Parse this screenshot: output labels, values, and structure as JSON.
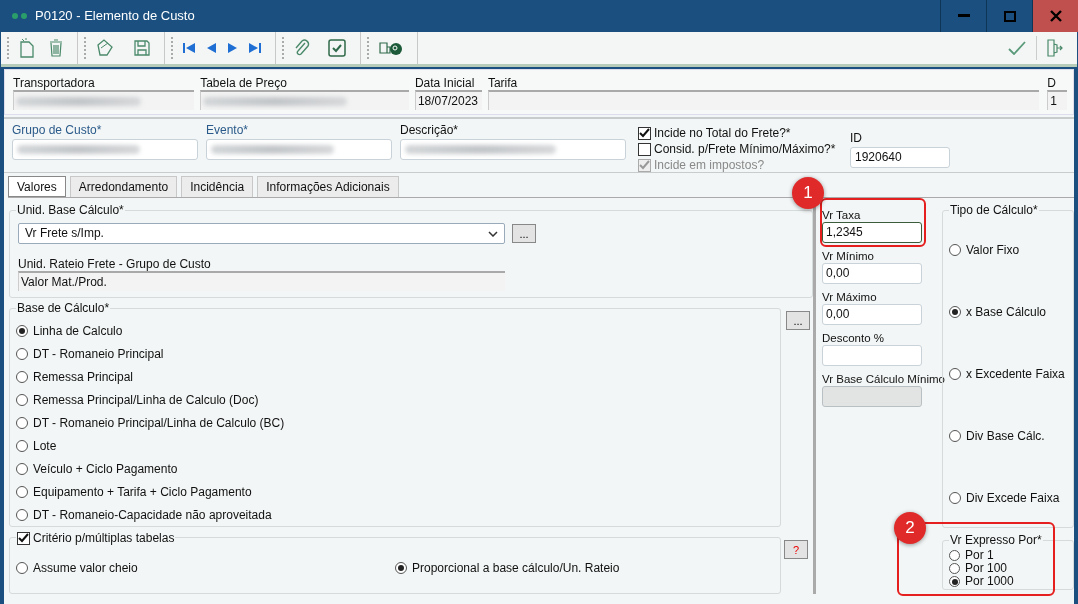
{
  "window": {
    "title": "P0120 - Elemento de Custo"
  },
  "header": {
    "fields": [
      {
        "label": "Transportadora",
        "redacted": true
      },
      {
        "label": "Tabela de Preço",
        "redacted": true
      },
      {
        "label": "Data Inicial",
        "value": "18/07/2023"
      },
      {
        "label": "Tarifa"
      },
      {
        "label": "D",
        "value": "1"
      }
    ]
  },
  "group": {
    "fields": [
      {
        "label": "Grupo de Custo*",
        "kind": "lookup",
        "redacted": true
      },
      {
        "label": "Evento*",
        "kind": "lookup",
        "redacted": true
      },
      {
        "label": "Descrição*",
        "kind": "text",
        "redacted": true
      }
    ],
    "checkboxes": [
      {
        "label": "Incide no Total do Frete?*",
        "checked": true,
        "disabled": false
      },
      {
        "label": "Consid. p/Frete Mínimo/Máximo?*",
        "checked": false,
        "disabled": false
      },
      {
        "label": "Incide em impostos?",
        "checked": true,
        "disabled": true
      }
    ],
    "id": {
      "label": "ID",
      "value": "1920640"
    }
  },
  "tabs": [
    {
      "label": "Valores",
      "selected": true
    },
    {
      "label": "Arredondamento",
      "selected": false
    },
    {
      "label": "Incidência",
      "selected": false
    },
    {
      "label": "Informações Adicionais",
      "selected": false
    }
  ],
  "unid_base": {
    "label": "Unid. Base Cálculo*",
    "value": "Vr Frete s/Imp.",
    "button": "..."
  },
  "unid_rateio": {
    "label": "Unid. Rateio Frete - Grupo de Custo",
    "value": "Valor Mat./Prod."
  },
  "base_calculo": {
    "label": "Base de Cálculo*",
    "button": "...",
    "options": [
      {
        "label": "Linha de Calculo",
        "selected": true
      },
      {
        "label": "DT - Romaneio Principal",
        "selected": false
      },
      {
        "label": "Remessa Principal",
        "selected": false
      },
      {
        "label": "Remessa Principal/Linha de Calculo (Doc)",
        "selected": false
      },
      {
        "label": "DT - Romaneio Principal/Linha de Calculo (BC)",
        "selected": false
      },
      {
        "label": "Lote",
        "selected": false
      },
      {
        "label": "Veículo + Ciclo Pagamento",
        "selected": false
      },
      {
        "label": "Equipamento + Tarifa + Ciclo Pagamento",
        "selected": false
      },
      {
        "label": "DT - Romaneio-Capacidade não aproveitada",
        "selected": false
      }
    ]
  },
  "criterio": {
    "label": "Critério p/múltiplas tabelas",
    "checked": true,
    "help_button": "?",
    "options": [
      {
        "label": "Assume valor cheio",
        "selected": false
      },
      {
        "label": "Proporcional a base cálculo/Un. Rateio",
        "selected": true
      }
    ]
  },
  "values": [
    {
      "label": "Vr Taxa",
      "value": "1,2345",
      "disabled": false
    },
    {
      "label": "Vr Mínimo",
      "value": "0,00",
      "disabled": false
    },
    {
      "label": "Vr Máximo",
      "value": "0,00",
      "disabled": false
    },
    {
      "label": "Desconto %",
      "disabled": false
    },
    {
      "label": "Vr Base Cálculo Mínimo",
      "disabled": true
    }
  ],
  "tipo_calculo": {
    "label": "Tipo de Cálculo*",
    "options": [
      {
        "label": "Valor Fixo",
        "selected": false
      },
      {
        "label": "x Base Cálculo",
        "selected": true
      },
      {
        "label": "x Excedente Faixa",
        "selected": false
      },
      {
        "label": "Div Base Cálc.",
        "selected": false
      },
      {
        "label": "Div Excede Faixa",
        "selected": false
      }
    ]
  },
  "vr_expresso": {
    "label": "Vr Expresso Por*",
    "options": [
      {
        "label": "Por 1",
        "selected": false
      },
      {
        "label": "Por 100",
        "selected": false
      },
      {
        "label": "Por 1000",
        "selected": true
      }
    ]
  },
  "annotations": [
    {
      "number": "1"
    },
    {
      "number": "2"
    }
  ]
}
